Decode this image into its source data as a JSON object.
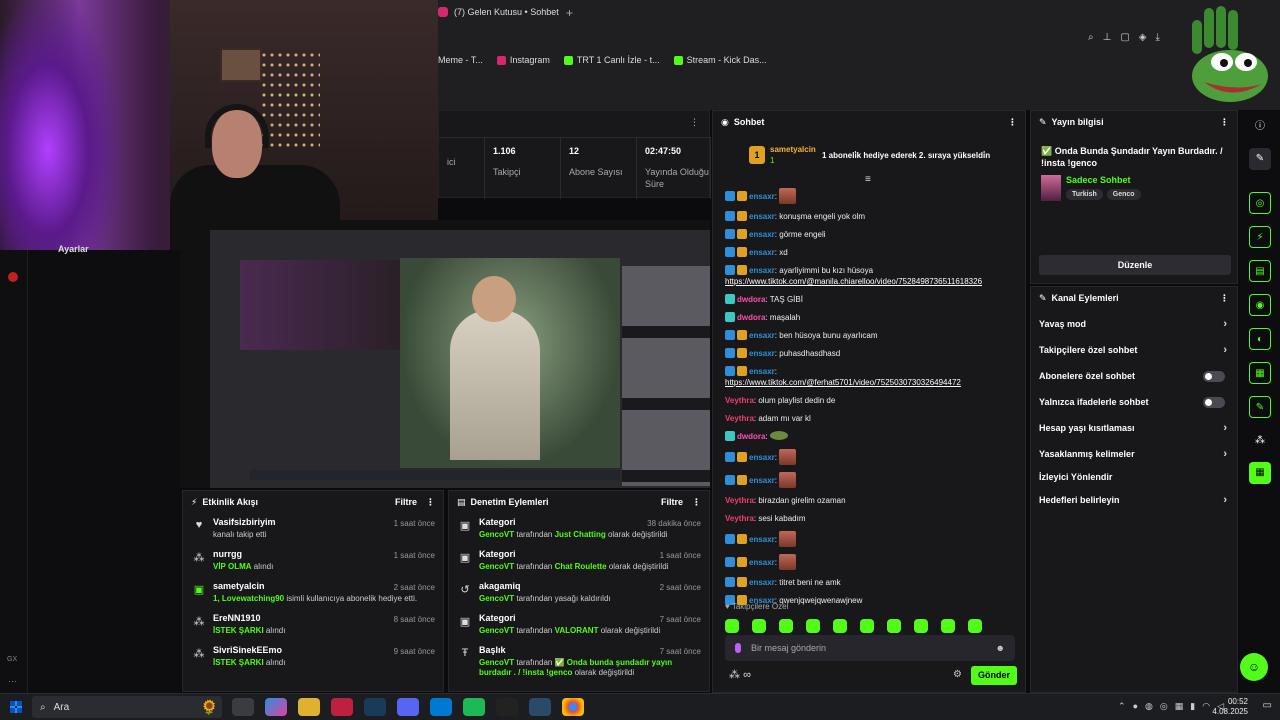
{
  "browser": {
    "tab_title": "(7) Gelen Kutusu • Sohbet",
    "new_tab": "+",
    "bookmarks": [
      {
        "label": "Meme - T...",
        "color": "#444444"
      },
      {
        "label": "Instagram",
        "color": "#d6286f"
      },
      {
        "label": "TRT 1 Canlı İzle - t...",
        "color": "#53fc18"
      },
      {
        "label": "Stream - Kick Das...",
        "color": "#53fc18"
      }
    ]
  },
  "stats": {
    "items": [
      {
        "value": "",
        "label": "ici"
      },
      {
        "value": "1.106",
        "label": "Takipçi"
      },
      {
        "value": "12",
        "label": "Abone Sayısı"
      },
      {
        "value": "02:47:50",
        "label": "Yayında Olduğu Süre"
      }
    ]
  },
  "left_nav": {
    "label": "Ayarlar",
    "gx": "GX"
  },
  "activity": {
    "title": "Etkinlik Akışı",
    "filter": "Filtre",
    "rows": [
      {
        "icon": "heart-icon",
        "name": "Vasifsizbiriyim",
        "time": "1 saat önce",
        "desc_green": "",
        "desc": "kanalı takip etti"
      },
      {
        "icon": "nodes-icon",
        "name": "nurrgg",
        "time": "1 saat önce",
        "desc_green": "VİP OLMA",
        "desc": " alındı"
      },
      {
        "icon": "gift-icon",
        "name": "sametyalcin",
        "time": "2 saat önce",
        "desc_green": "1, Lovewatching90",
        "desc": " isimli kullanıcıya abonelik hediye etti."
      },
      {
        "icon": "nodes-icon",
        "name": "EreNN1910",
        "time": "8 saat önce",
        "desc_green": "İSTEK ŞARKI",
        "desc": " alındı"
      },
      {
        "icon": "nodes-icon",
        "name": "SivriSinekEEmo",
        "time": "9 saat önce",
        "desc_green": "İSTEK ŞARKI",
        "desc": " alındı"
      }
    ]
  },
  "moderation": {
    "title": "Denetim Eylemleri",
    "filter": "Filtre",
    "rows": [
      {
        "icon": "category-icon",
        "name": "Kategori",
        "time": "38 dakika önce",
        "user": "GencoVT",
        "mid": " tarafından ",
        "target": "Just Chatting",
        "end": " olarak değiştirildi"
      },
      {
        "icon": "category-icon",
        "name": "Kategori",
        "time": "1 saat önce",
        "user": "GencoVT",
        "mid": " tarafından ",
        "target": "Chat Roulette",
        "end": " olarak değiştirildi"
      },
      {
        "icon": "undo-icon",
        "name": "akagamiq",
        "time": "2 saat önce",
        "user": "GencoVT",
        "mid": " tarafından yasağı kaldırıldı",
        "target": "",
        "end": ""
      },
      {
        "icon": "category-icon",
        "name": "Kategori",
        "time": "7 saat önce",
        "user": "GencoVT",
        "mid": " tarafından ",
        "target": "VALORANT",
        "end": " olarak değiştirildi"
      },
      {
        "icon": "title-icon",
        "name": "Başlık",
        "time": "7 saat önce",
        "user": "GencoVT",
        "mid": " tarafından ",
        "target": "✅ Onda bunda şundadır yayın burdadır . / !insta !genco",
        "end": " olarak değiştirildi"
      }
    ]
  },
  "chat": {
    "title": "Sohbet",
    "pinned": {
      "badge": "1",
      "user": "sametyalcin",
      "count": "1",
      "message": "1 aboneli̇k hediye ederek 2. sıraya yükseldi̇n"
    },
    "messages": [
      {
        "user": "ensaxr",
        "color": "u1",
        "text": "",
        "emote": "emo",
        "link": ""
      },
      {
        "user": "ensaxr",
        "color": "u1",
        "text": "konuşma engeli yok olm",
        "emote": "",
        "link": ""
      },
      {
        "user": "ensaxr",
        "color": "u1",
        "text": "görme engeli",
        "emote": "",
        "link": ""
      },
      {
        "user": "ensaxr",
        "color": "u1",
        "text": "xd",
        "emote": "",
        "link": ""
      },
      {
        "user": "ensaxr",
        "color": "u1",
        "text": "ayarliyimmi bu kızı hüsoya",
        "emote": "",
        "link": "https://www.tiktok.com/@manila.chiarelloo/video/7528498736511618326"
      },
      {
        "user": "dwdora",
        "color": "u3",
        "text": "TAŞ GİBİ",
        "emote": "",
        "link": ""
      },
      {
        "user": "dwdora",
        "color": "u3",
        "text": "maşalah",
        "emote": "",
        "link": ""
      },
      {
        "user": "ensaxr",
        "color": "u1",
        "text": "ben hüsoya bunu ayarlıcam",
        "emote": "",
        "link": ""
      },
      {
        "user": "ensaxr",
        "color": "u1",
        "text": "puhasdhasdhasd",
        "emote": "",
        "link": ""
      },
      {
        "user": "ensaxr",
        "color": "u1",
        "text": "",
        "emote": "",
        "link": "https://www.tiktok.com/@ferhat5701/video/7525030730326494472"
      },
      {
        "user": "Veythra",
        "color": "u2",
        "text": "olum playlist dedin de",
        "emote": "",
        "link": ""
      },
      {
        "user": "Veythra",
        "color": "u2",
        "text": "adam mı var kl",
        "emote": "",
        "link": ""
      },
      {
        "user": "dwdora",
        "color": "u3",
        "text": "",
        "emote": "emo2",
        "link": ""
      },
      {
        "user": "ensaxr",
        "color": "u1",
        "text": "",
        "emote": "emo",
        "link": ""
      },
      {
        "user": "ensaxr",
        "color": "u1",
        "text": "",
        "emote": "emo",
        "link": ""
      },
      {
        "user": "Veythra",
        "color": "u2",
        "text": "birazdan girelim ozaman",
        "emote": "",
        "link": ""
      },
      {
        "user": "Veythra",
        "color": "u2",
        "text": "sesi kabadım",
        "emote": "",
        "link": ""
      },
      {
        "user": "ensaxr",
        "color": "u1",
        "text": "",
        "emote": "emo",
        "link": ""
      },
      {
        "user": "ensaxr",
        "color": "u1",
        "text": "",
        "emote": "emo",
        "link": ""
      },
      {
        "user": "ensaxr",
        "color": "u1",
        "text": "titret beni ne amk",
        "emote": "",
        "link": ""
      },
      {
        "user": "ensaxr",
        "color": "u1",
        "text": "qwenjqwejqwenawjnew",
        "emote": "",
        "link": ""
      }
    ],
    "followers_only": "Takipçilere Özel",
    "input_placeholder": "Bir mesaj gönderin",
    "send": "Gönder",
    "infinity": "∞"
  },
  "stream_info": {
    "title": "Yayın bilgisi",
    "stream_title": "✅ Onda Bunda Şundadır Yayın Burdadır. / !insta !genco",
    "category": "Sadece Sohbet",
    "tags": [
      "Turkish",
      "Genco"
    ],
    "edit": "Düzenle"
  },
  "channel_actions": {
    "title": "Kanal Eylemleri",
    "items": [
      {
        "label": "Yavaş mod",
        "control": "arrow"
      },
      {
        "label": "Takipçilere özel sohbet",
        "control": "arrow"
      },
      {
        "label": "Abonelere özel sohbet",
        "control": "toggle"
      },
      {
        "label": "Yalnızca ifadelerle sohbet",
        "control": "toggle"
      },
      {
        "label": "Hesap yaşı kısıtlaması",
        "control": "arrow"
      },
      {
        "label": "Yasaklanmış kelimeler",
        "control": "arrow"
      },
      {
        "label": "İzleyici Yönlendir",
        "control": "none"
      },
      {
        "label": "Hedefleri belirleyin",
        "control": "arrow"
      }
    ]
  },
  "taskbar": {
    "search": "Ara",
    "time": "00:52",
    "date": "4.08.2025"
  },
  "colors": {
    "accent": "#53fc18",
    "panel": "#18181b",
    "bg": "#0b0b0d"
  }
}
